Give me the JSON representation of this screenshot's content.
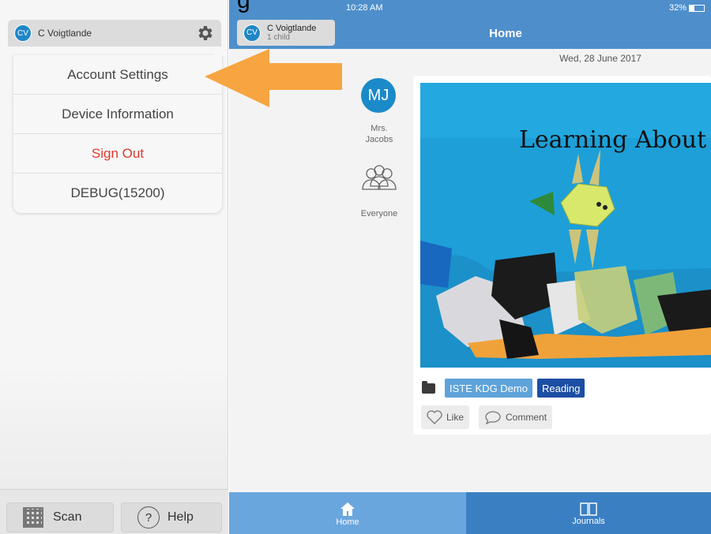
{
  "overlay": {
    "cut_title": "g"
  },
  "sidebar": {
    "user": {
      "initials": "CV",
      "name": "C Voigtlande"
    },
    "menu": [
      {
        "label": "Account Settings",
        "style": "normal"
      },
      {
        "label": "Device Information",
        "style": "normal"
      },
      {
        "label": "Sign Out",
        "style": "red"
      },
      {
        "label": "DEBUG(15200)",
        "style": "normal"
      }
    ],
    "bottom": {
      "scan_label": "Scan",
      "help_label": "Help",
      "help_glyph": "?"
    }
  },
  "status": {
    "time": "10:28 AM",
    "battery": "32%"
  },
  "header": {
    "child": {
      "initials": "CV",
      "name": "C Voigtlande",
      "sub": "1 child"
    },
    "title": "Home"
  },
  "feed": {
    "date": "Wed, 28 June 2017",
    "teacher": {
      "initials": "MJ",
      "name_line1": "Mrs.",
      "name_line2": "Jacobs"
    },
    "audience": "Everyone",
    "post": {
      "photo_text": "Learning About",
      "tags": [
        "ISTE KDG Demo",
        "Reading"
      ],
      "like_label": "Like",
      "comment_label": "Comment"
    }
  },
  "tabbar": {
    "home_label": "Home",
    "journals_label": "Journals"
  },
  "colors": {
    "header_blue": "#4e8fcb",
    "accent_orange": "#f7a541",
    "signout_red": "#e03a2f",
    "tag_dark": "#1c4ea4",
    "tag_light": "#5ea3da"
  },
  "icons": {
    "gear": "gear-icon",
    "home": "home-icon",
    "journals": "book-icon",
    "people": "people-icon",
    "folder": "folder-icon",
    "heart": "heart-icon",
    "comment": "comment-icon",
    "qr": "qr-code-icon",
    "help": "help-icon"
  }
}
